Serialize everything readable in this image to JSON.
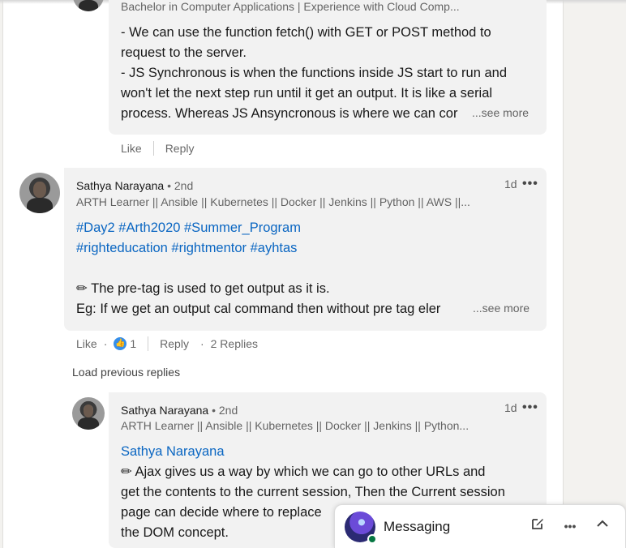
{
  "comment_top": {
    "headline": "Bachelor in Computer Applications | Experience with Cloud Comp...",
    "body_lines": [
      "- We can use the function fetch() with GET or POST method to",
      "request to the server.",
      "- JS Synchronous is when the functions inside JS start to run and",
      "won't let the next step run until it get an output. It is like a serial",
      "process. Whereas JS Ansyncronous is where we can cor"
    ],
    "see_more": "...see more",
    "like_label": "Like",
    "reply_label": "Reply"
  },
  "comment_main": {
    "name": "Sathya Narayana",
    "degree": "• 2nd",
    "headline": "ARTH Learner || Ansible || Kubernetes || Docker || Jenkins || Python || AWS ||...",
    "time": "1d",
    "more_label": "•••",
    "hashtags_line1": "#Day2 #Arth2020 #Summer_Program",
    "hashtags_line2": "#righteducation #rightmentor #ayhtas",
    "pencil": "✏",
    "text_line1": "The pre-tag is used to get output as it is.",
    "text_line2": "Eg: If we get an output cal command then without pre tag eler",
    "see_more": "...see more",
    "like_label": "Like",
    "reaction_count": "1",
    "reply_label": "Reply",
    "replies_label": "2 Replies"
  },
  "load_previous": "Load previous replies",
  "reply": {
    "name": "Sathya Narayana",
    "degree": "• 2nd",
    "headline": "ARTH Learner || Ansible || Kubernetes || Docker || Jenkins || Python...",
    "time": "1d",
    "more_label": "•••",
    "mention": "Sathya Narayana",
    "pencil": "✏",
    "lines": [
      "Ajax gives us a way by which we can go to other URLs and",
      "get the contents to the current session, Then the Current session",
      "page can decide where to replace",
      "the DOM concept."
    ]
  },
  "messaging": {
    "title": "Messaging",
    "compose_icon": "compose-icon",
    "more_label": "•••",
    "collapse_glyph": "︿"
  },
  "colors": {
    "link_blue": "#0a66c2",
    "bubble_bg": "#f2f2f2",
    "online_green": "#057642"
  }
}
